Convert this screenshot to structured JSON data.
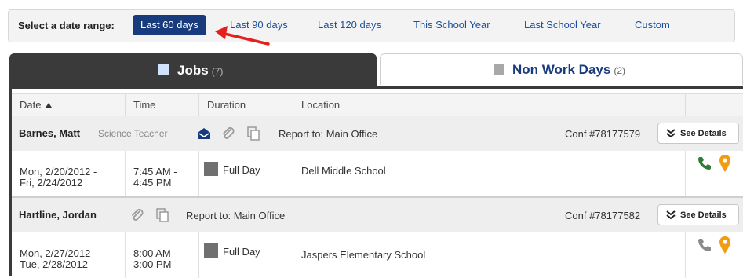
{
  "date_range": {
    "label": "Select a date range:",
    "options": [
      {
        "label": "Last 60 days",
        "active": true
      },
      {
        "label": "Last 90 days",
        "active": false
      },
      {
        "label": "Last 120 days",
        "active": false
      },
      {
        "label": "This School Year",
        "active": false
      },
      {
        "label": "Last School Year",
        "active": false
      },
      {
        "label": "Custom",
        "active": false
      }
    ]
  },
  "tabs": {
    "jobs": {
      "label": "Jobs",
      "count": "(7)"
    },
    "non_work_days": {
      "label": "Non Work Days",
      "count": "(2)"
    }
  },
  "columns": [
    "Date",
    "Time",
    "Duration",
    "Location"
  ],
  "jobs": [
    {
      "name": "Barnes, Matt",
      "role": "Science Teacher",
      "report_to": "Report to: Main Office",
      "conf": "Conf #78177579",
      "see_details": "See Details",
      "date_line1": "Mon, 2/20/2012 -",
      "date_line2": "Fri, 2/24/2012",
      "time_line1": "7:45 AM -",
      "time_line2": "4:45 PM",
      "duration": "Full Day",
      "location": "Dell Middle School"
    },
    {
      "name": "Hartline, Jordan",
      "role": "",
      "report_to": "Report to: Main Office",
      "conf": "Conf #78177582",
      "see_details": "See Details",
      "date_line1": "Mon, 2/27/2012 -",
      "date_line2": "Tue, 2/28/2012",
      "time_line1": "8:00 AM -",
      "time_line2": "3:00 PM",
      "duration": "Full Day",
      "location": "Jaspers Elementary School"
    }
  ],
  "colors": {
    "active_range": "#173b7c",
    "link": "#1a4e9c",
    "tab_dark": "#3a3a3a",
    "phone_green": "#2e7d32",
    "pin_orange": "#f39c12",
    "arrow_red": "#e3201b"
  },
  "icons": {
    "email": "envelope-open-icon",
    "attachment": "paperclip-icon",
    "copy": "copy-icon",
    "phone": "phone-icon",
    "location": "map-pin-icon",
    "details": "double-chevron-down-icon"
  }
}
